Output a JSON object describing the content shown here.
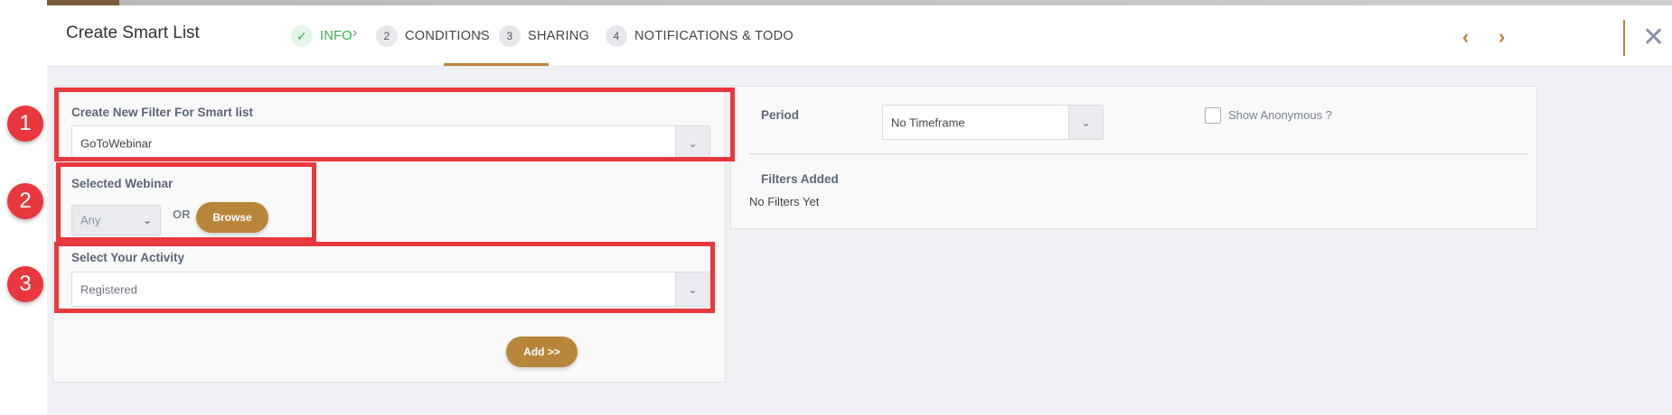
{
  "header": {
    "title": "Create Smart List",
    "steps": [
      {
        "number": "✓",
        "label": "INFO",
        "state": "done"
      },
      {
        "number": "2",
        "label": "CONDITIONS",
        "state": "active"
      },
      {
        "number": "3",
        "label": "SHARING",
        "state": "pending"
      },
      {
        "number": "4",
        "label": "NOTIFICATIONS & TODO",
        "state": "pending"
      }
    ],
    "prev_icon": "chevron-left-icon",
    "next_icon": "chevron-right-icon",
    "close_icon": "close-icon"
  },
  "left_panel": {
    "filter_label": "Create New Filter For Smart list",
    "filter_value": "GoToWebinar",
    "webinar_label": "Selected Webinar",
    "webinar_value": "Any",
    "or_text": "OR",
    "browse_label": "Browse",
    "activity_label": "Select Your Activity",
    "activity_value": "Registered",
    "add_label": "Add >>"
  },
  "right_panel": {
    "period_label": "Period",
    "period_value": "No Timeframe",
    "show_anonymous_label": "Show Anonymous ?",
    "show_anonymous_checked": false,
    "filters_added_label": "Filters Added",
    "filters_added_value": "No Filters Yet"
  },
  "annotations": [
    "1",
    "2",
    "3"
  ],
  "colors": {
    "accent": "#b8863b",
    "success": "#2db34a",
    "annotation": "#e8383e"
  }
}
